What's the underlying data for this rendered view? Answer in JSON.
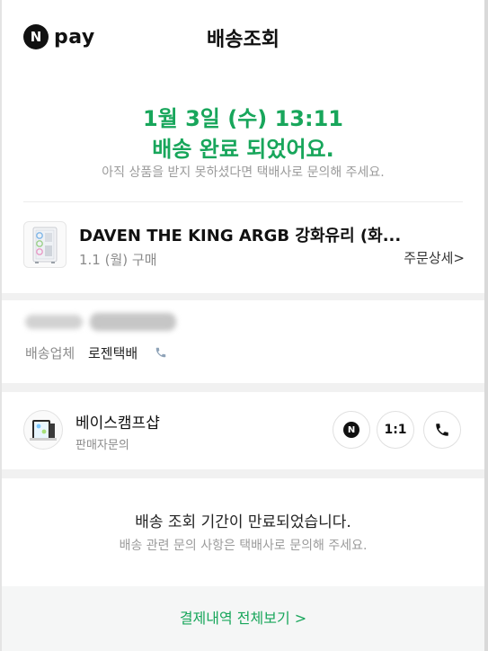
{
  "header": {
    "logo_badge": "N",
    "logo_text": "pay",
    "title": "배송조회"
  },
  "status": {
    "date": "1월 3일 (수) 13:11",
    "message": "배송 완료 되었어요.",
    "hint": "아직 상품을 받지 못하셨다면 택배사로 문의해 주세요."
  },
  "product": {
    "name": "DAVEN THE KING ARGB 강화유리 (화...",
    "date": "1.1 (월) 구매",
    "order_detail": "주문상세",
    "order_detail_chevron": ">"
  },
  "delivery": {
    "carrier_label": "배송업체",
    "carrier_name": "로젠택배",
    "phone_icon": "phone-icon"
  },
  "seller": {
    "name": "베이스캠프샵",
    "sub": "판매자문의",
    "buttons": {
      "naver_talk": "N",
      "one_on_one": "1:1",
      "call_icon": "phone-icon"
    }
  },
  "expired": {
    "main": "배송 조회 기간이 만료되었습니다.",
    "sub": "배송 관련 문의 사항은 택배사로 문의해 주세요."
  },
  "footer": {
    "link": "결제내역 전체보기 >"
  },
  "colors": {
    "accent": "#18a65b",
    "background": "#f1f1f1",
    "muted": "#9b9b9b"
  }
}
